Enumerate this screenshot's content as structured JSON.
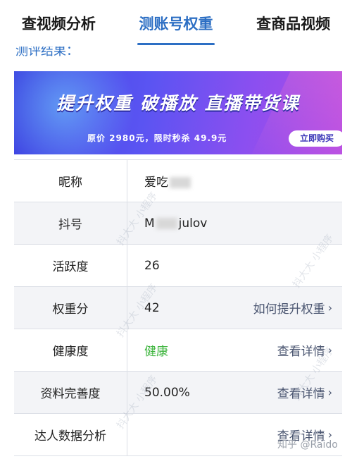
{
  "tabs": [
    {
      "label": "查视频分析"
    },
    {
      "label": "测账号权重"
    },
    {
      "label": "查商品视频"
    }
  ],
  "section_title": "测评结果：",
  "banner": {
    "headline": "提升权重 破播放 直播带货课",
    "subtitle": "原价 2980元，限时秒杀 49.9元",
    "button": "立即购买"
  },
  "table": {
    "rows": [
      {
        "label": "昵称",
        "value": "爱吃",
        "link": ""
      },
      {
        "label": "抖号",
        "value_left": "M",
        "value_right": "julov",
        "link": ""
      },
      {
        "label": "活跃度",
        "value": "26",
        "link": ""
      },
      {
        "label": "权重分",
        "value": "42",
        "link": "如何提升权重"
      },
      {
        "label": "健康度",
        "value": "健康",
        "link": "查看详情"
      },
      {
        "label": "资料完善度",
        "value": "50.00%",
        "link": "查看详情"
      },
      {
        "label": "达人数据分析",
        "value": "",
        "link": "查看详情"
      }
    ]
  },
  "watermark": "知乎 @Raido",
  "diag_watermark": "抖大大 小程序",
  "colors": {
    "accent": "#2d6fc4",
    "healthy": "#3cb43c"
  },
  "icons": {
    "chevron": "chevron-right-icon"
  }
}
